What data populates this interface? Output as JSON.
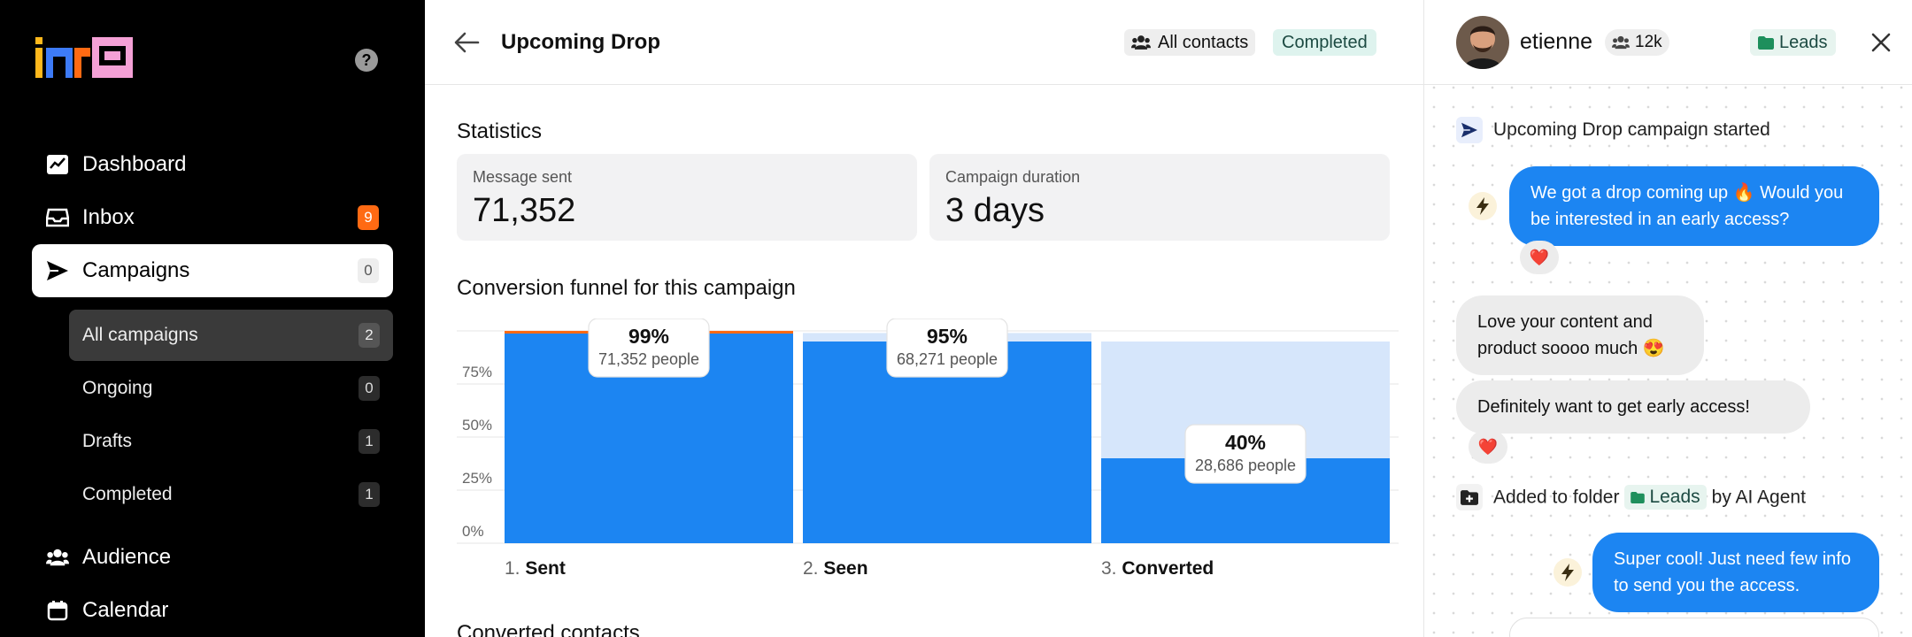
{
  "sidebar": {
    "help_icon": "?",
    "nav": [
      {
        "label": "Dashboard",
        "icon": "chart-icon"
      },
      {
        "label": "Inbox",
        "icon": "inbox-icon",
        "badge": "9"
      },
      {
        "label": "Campaigns",
        "icon": "send-icon",
        "badge": "0"
      }
    ],
    "sub_nav": [
      {
        "label": "All campaigns",
        "badge": "2"
      },
      {
        "label": "Ongoing",
        "badge": "0"
      },
      {
        "label": "Drafts",
        "badge": "1"
      },
      {
        "label": "Completed",
        "badge": "1"
      }
    ],
    "nav_bottom": [
      {
        "label": "Audience",
        "icon": "users-icon"
      },
      {
        "label": "Calendar",
        "icon": "calendar-icon"
      }
    ]
  },
  "main": {
    "title": "Upcoming Drop",
    "contacts_label": "All contacts",
    "status": "Completed",
    "statistics_heading": "Statistics",
    "stats": [
      {
        "label": "Message sent",
        "value": "71,352"
      },
      {
        "label": "Campaign duration",
        "value": "3 days"
      }
    ],
    "funnel_heading": "Conversion funnel for this campaign",
    "converted_heading": "Converted contacts"
  },
  "chart_data": {
    "type": "bar",
    "title": "Conversion funnel for this campaign",
    "y_ticks": [
      "0%",
      "25%",
      "50%",
      "75%"
    ],
    "ylim": [
      0,
      100
    ],
    "grid": true,
    "categories": [
      {
        "num": "1.",
        "name": "Sent"
      },
      {
        "num": "2.",
        "name": "Seen"
      },
      {
        "num": "3.",
        "name": "Converted"
      }
    ],
    "values": [
      99,
      95,
      40
    ],
    "base_values": [
      100,
      99,
      95
    ],
    "labels": [
      "99%",
      "95%",
      "40%"
    ],
    "people": [
      "71,352 people",
      "68,271 people",
      "28,686 people"
    ],
    "colors": {
      "bar": "#1c85f2",
      "track": "#d6e6fb",
      "loss": "#ff6a13"
    }
  },
  "chat": {
    "username": "etienne",
    "followers": "12k",
    "folder": "Leads",
    "events": {
      "campaign_name": "Upcoming Drop",
      "campaign_text": "campaign started",
      "added_prefix": "Added to folder",
      "added_folder": "Leads",
      "added_suffix": "by AI Agent"
    },
    "messages": [
      {
        "text": "We got a drop coming up 🔥 Would you be interested in an early access?"
      },
      {
        "text": "Love your content and product soooo much 😍"
      },
      {
        "text": "Definitely want to get early access!"
      },
      {
        "text": "Super cool! Just need few info to send you the access."
      }
    ],
    "reaction": "❤️"
  }
}
